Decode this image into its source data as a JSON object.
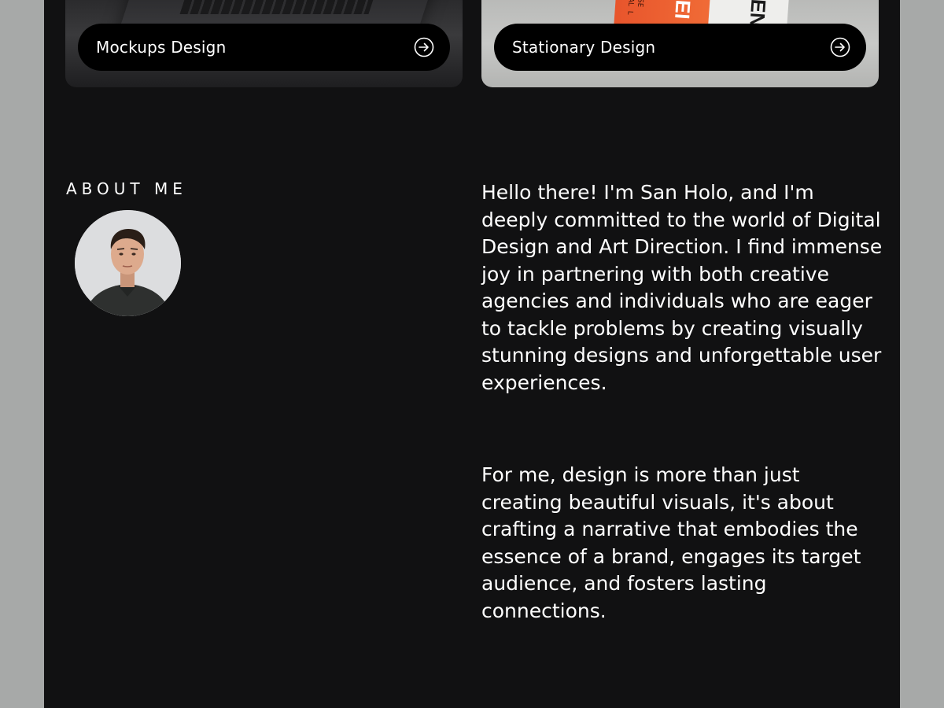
{
  "portfolio_cards": [
    {
      "label": "Mockups Design",
      "icon": "arrow-right-circle-icon"
    },
    {
      "label": "Stationary Design",
      "icon": "arrow-right-circle-icon"
    }
  ],
  "stationary_image_text": {
    "small_line_1": "ROYAL L",
    "small_line_2": "JERSE",
    "big_letters_1": "EI",
    "big_letters_2": "ENN"
  },
  "about": {
    "heading": "ABOUT ME",
    "avatar_alt": "avatar",
    "paragraphs": [
      "Hello there! I'm San Holo, and I'm deeply committed to the world of Digital Design and Art Direction. I find immense joy in partnering with both creative agencies and individuals who are eager to tackle problems by creating visually stunning designs and unforgettable user experiences.",
      "For me, design is more than just creating beautiful visuals, it's about crafting a narrative that embodies the essence of a brand, engages its target audience, and fosters lasting connections."
    ]
  },
  "colors": {
    "page_background": "#111112",
    "outer_background": "#a7a9a8",
    "pill_background": "#000000",
    "text": "#ffffff",
    "accent_orange": "#e8552c"
  }
}
